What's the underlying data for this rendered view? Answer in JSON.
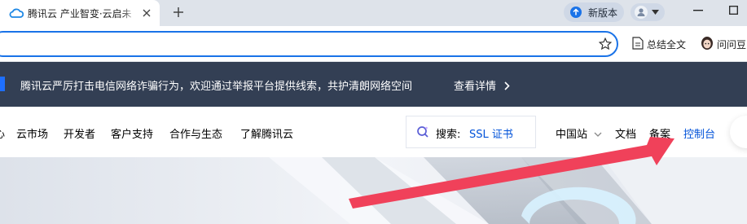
{
  "browser": {
    "tab_title": "腾讯云 产业智变·云启未",
    "new_version_label": "新版本",
    "bookmarks": [
      {
        "label": "总结全文",
        "icon": "summary-doc-icon"
      },
      {
        "label": "问问豆",
        "icon": "doubao-avatar-icon"
      }
    ]
  },
  "notice": {
    "text": "腾讯云严厉打击电信网络诈骗行为，欢迎通过举报平台提供线索，共护清朗网络空间",
    "link_label": "查看详情"
  },
  "header": {
    "nav_partial": "心",
    "nav_items": [
      "云市场",
      "开发者",
      "客户支持",
      "合作与生态",
      "了解腾讯云"
    ],
    "search_label": "搜索:",
    "search_hint": "SSL 证书",
    "region_label": "中国站",
    "docs_label": "文档",
    "beian_label": "备案",
    "console_label": "控制台"
  },
  "colors": {
    "brand_blue": "#0052d9",
    "notice_bg": "#333f54",
    "annotation_arrow": "#f0415a"
  }
}
